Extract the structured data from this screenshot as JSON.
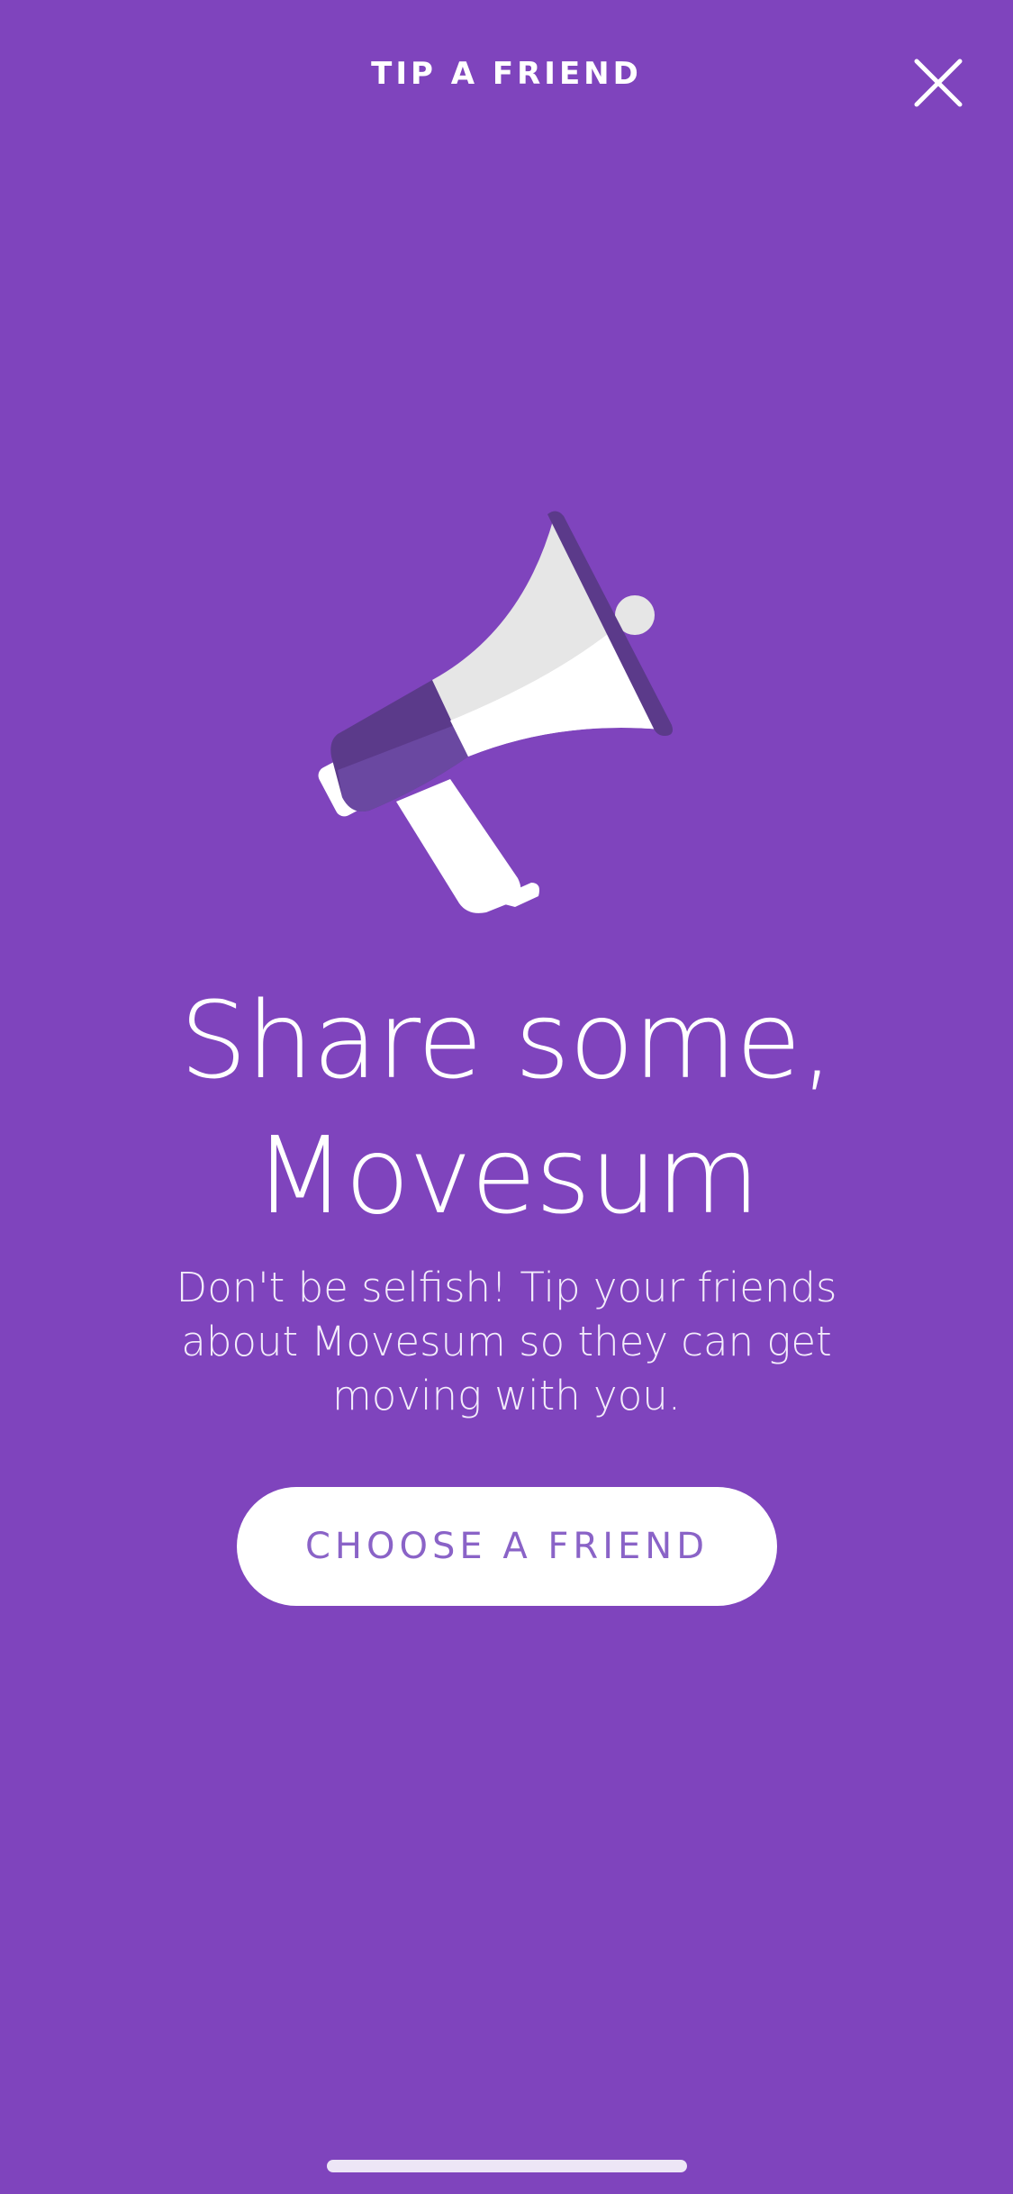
{
  "header": {
    "title": "TIP A FRIEND",
    "close_icon": "close-icon"
  },
  "illustration": {
    "icon": "megaphone-icon",
    "colors": {
      "primary": "#FFFFFF",
      "shade": "#E6E6E6",
      "accent_dark": "#5B3A8A",
      "accent_mid": "#6A48A1"
    }
  },
  "main": {
    "headline_line1": "Share some,",
    "headline_line2": "Movesum",
    "description": "Don't be selfish! Tip your friends about Movesum so they can get moving with you.",
    "button_label": "CHOOSE A FRIEND"
  },
  "colors": {
    "background": "#7F44BD",
    "button_background": "#FFFFFF",
    "button_text": "#8A63C7"
  }
}
